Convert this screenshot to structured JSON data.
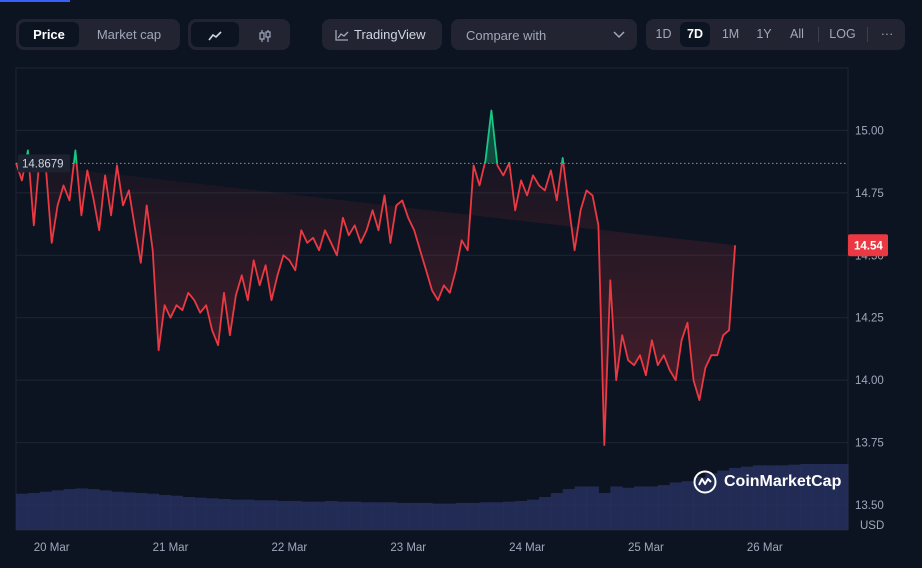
{
  "toggle": {
    "price": "Price",
    "market_cap": "Market cap"
  },
  "toolbar": {
    "tradingview": "TradingView",
    "compare_placeholder": "Compare with",
    "timeframes": [
      "1D",
      "7D",
      "1M",
      "1Y",
      "All"
    ],
    "timeframe_selected": "7D",
    "log": "LOG",
    "more": "···"
  },
  "chart_data": {
    "type": "line",
    "currency": "USD",
    "watermark": "CoinMarketCap",
    "reference_price": 14.8679,
    "reference_label": "14.8679",
    "last_price": 14.54,
    "last_price_label": "14.54",
    "y_ticks": [
      "15.00",
      "14.75",
      "14.50",
      "14.25",
      "14.00",
      "13.75",
      "13.50"
    ],
    "y_tick_values": [
      15.0,
      14.75,
      14.5,
      14.25,
      14.0,
      13.75,
      13.5
    ],
    "ylim": [
      13.4,
      15.25
    ],
    "x_ticks": [
      "20 Mar",
      "21 Mar",
      "22 Mar",
      "23 Mar",
      "24 Mar",
      "25 Mar",
      "26 Mar"
    ],
    "x_tick_values": [
      0.3,
      1.3,
      2.3,
      3.3,
      4.3,
      5.3,
      6.3
    ],
    "xlim": [
      0,
      7
    ],
    "x_unit": "days",
    "above_color": "#16c784",
    "below_color": "#ea3943",
    "x": [
      0.0,
      0.05,
      0.1,
      0.15,
      0.2,
      0.25,
      0.3,
      0.35,
      0.4,
      0.45,
      0.5,
      0.55,
      0.6,
      0.65,
      0.7,
      0.75,
      0.8,
      0.85,
      0.9,
      0.95,
      1.0,
      1.05,
      1.1,
      1.15,
      1.2,
      1.25,
      1.3,
      1.35,
      1.4,
      1.45,
      1.5,
      1.55,
      1.6,
      1.65,
      1.7,
      1.75,
      1.8,
      1.85,
      1.9,
      1.95,
      2.0,
      2.05,
      2.1,
      2.15,
      2.2,
      2.25,
      2.3,
      2.35,
      2.4,
      2.45,
      2.5,
      2.55,
      2.6,
      2.65,
      2.7,
      2.75,
      2.8,
      2.85,
      2.9,
      2.95,
      3.0,
      3.05,
      3.1,
      3.15,
      3.2,
      3.25,
      3.3,
      3.35,
      3.4,
      3.45,
      3.5,
      3.55,
      3.6,
      3.65,
      3.7,
      3.75,
      3.8,
      3.85,
      3.9,
      3.95,
      4.0,
      4.05,
      4.1,
      4.15,
      4.2,
      4.25,
      4.3,
      4.35,
      4.4,
      4.45,
      4.5,
      4.55,
      4.6,
      4.65,
      4.7,
      4.75,
      4.8,
      4.85,
      4.9,
      4.95,
      5.0,
      5.05,
      5.1,
      5.15,
      5.2,
      5.25,
      5.3,
      5.35,
      5.4,
      5.45,
      5.5,
      5.55,
      5.6,
      5.65,
      5.7,
      5.75,
      5.8,
      5.85,
      5.9,
      5.95,
      6.0,
      6.05,
      6.1,
      6.15,
      6.2,
      6.25,
      6.3,
      6.35,
      6.4,
      6.45,
      6.5,
      6.55,
      6.6,
      6.65,
      6.7,
      6.75,
      6.8,
      6.85,
      6.9,
      6.95,
      7.0
    ],
    "y": [
      14.87,
      14.8,
      14.92,
      14.62,
      14.9,
      14.86,
      14.55,
      14.7,
      14.78,
      14.72,
      14.92,
      14.66,
      14.84,
      14.73,
      14.6,
      14.82,
      14.66,
      14.86,
      14.7,
      14.76,
      14.61,
      14.47,
      14.7,
      14.52,
      14.12,
      14.3,
      14.25,
      14.3,
      14.28,
      14.35,
      14.32,
      14.27,
      14.3,
      14.2,
      14.14,
      14.35,
      14.18,
      14.34,
      14.42,
      14.32,
      14.48,
      14.38,
      14.46,
      14.32,
      14.42,
      14.5,
      14.48,
      14.44,
      14.6,
      14.55,
      14.57,
      14.52,
      14.6,
      14.55,
      14.5,
      14.65,
      14.58,
      14.62,
      14.55,
      14.6,
      14.68,
      14.6,
      14.74,
      14.55,
      14.7,
      14.72,
      14.65,
      14.6,
      14.52,
      14.44,
      14.36,
      14.32,
      14.38,
      14.35,
      14.44,
      14.56,
      14.52,
      14.86,
      14.78,
      14.88,
      15.08,
      14.86,
      14.82,
      14.87,
      14.68,
      14.8,
      14.74,
      14.82,
      14.78,
      14.76,
      14.84,
      14.72,
      14.89,
      14.7,
      14.52,
      14.68,
      14.76,
      14.74,
      14.62,
      13.74,
      14.4,
      14.0,
      14.18,
      14.08,
      14.06,
      14.1,
      14.02,
      14.16,
      14.06,
      14.1,
      14.04,
      14.0,
      14.16,
      14.23,
      14.0,
      13.92,
      14.05,
      14.1,
      14.1,
      14.18,
      14.2,
      14.54
    ],
    "volume": [
      0.55,
      0.56,
      0.58,
      0.6,
      0.62,
      0.63,
      0.62,
      0.6,
      0.58,
      0.57,
      0.56,
      0.55,
      0.53,
      0.52,
      0.5,
      0.49,
      0.48,
      0.47,
      0.46,
      0.46,
      0.45,
      0.45,
      0.44,
      0.44,
      0.43,
      0.43,
      0.44,
      0.43,
      0.43,
      0.42,
      0.42,
      0.42,
      0.41,
      0.41,
      0.41,
      0.4,
      0.4,
      0.41,
      0.41,
      0.42,
      0.42,
      0.43,
      0.44,
      0.46,
      0.5,
      0.56,
      0.62,
      0.66,
      0.66,
      0.56,
      0.66,
      0.64,
      0.66,
      0.66,
      0.68,
      0.72,
      0.74,
      0.8,
      0.86,
      0.9,
      0.94,
      0.96,
      0.98,
      0.98,
      0.98,
      0.99,
      1.0,
      1.0,
      1.0,
      1.0
    ]
  }
}
